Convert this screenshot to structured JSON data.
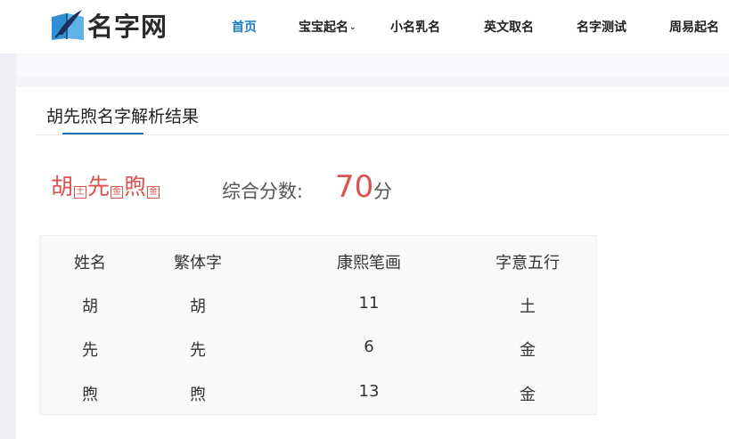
{
  "header": {
    "logo_text": "名字网",
    "nav": [
      {
        "label": "首页",
        "active": true
      },
      {
        "label": "宝宝起名",
        "has_dropdown": true
      },
      {
        "label": "小名乳名"
      },
      {
        "label": "英文取名"
      },
      {
        "label": "名字测试"
      },
      {
        "label": "周易起名"
      }
    ]
  },
  "panel": {
    "title": "胡先煦名字解析结果"
  },
  "name": {
    "chars": [
      {
        "char": "胡",
        "element": "土"
      },
      {
        "char": "先",
        "element": "金"
      },
      {
        "char": "煦",
        "element": "金"
      }
    ],
    "score_label": "综合分数:",
    "score_value": "70",
    "score_unit": "分"
  },
  "table": {
    "headers": [
      "姓名",
      "繁体字",
      "康熙笔画",
      "字意五行"
    ],
    "rows": [
      [
        "胡",
        "胡",
        "11",
        "土"
      ],
      [
        "先",
        "先",
        "6",
        "金"
      ],
      [
        "煦",
        "煦",
        "13",
        "金"
      ]
    ]
  },
  "colors": {
    "accent": "#1a7fc1",
    "name_red": "#d9534f"
  }
}
